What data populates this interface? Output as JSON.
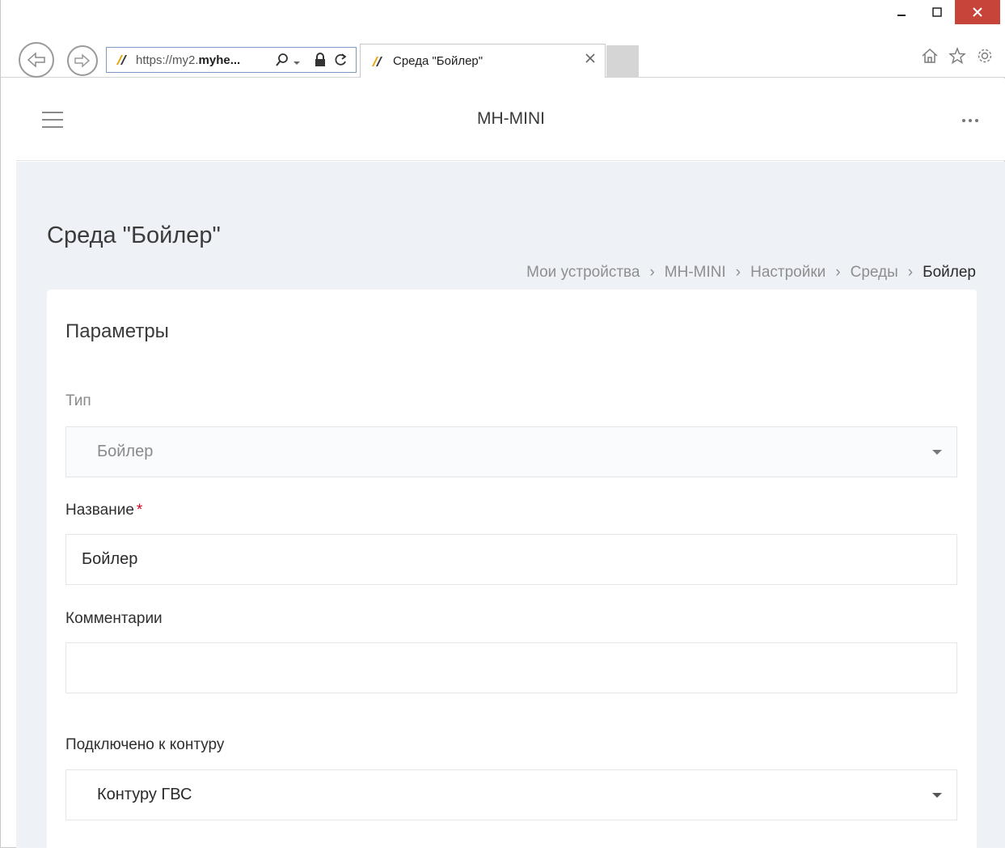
{
  "browser": {
    "address_url_prefix": "https://my2.",
    "address_url_domain": "myhe...",
    "tab_title": "Среда \"Бойлер\""
  },
  "app": {
    "title": "MH-MINI"
  },
  "page": {
    "title": "Среда \"Бойлер\"",
    "breadcrumb": [
      "Мои устройства",
      "MH-MINI",
      "Настройки",
      "Среды",
      "Бойлер"
    ]
  },
  "form": {
    "section_title": "Параметры",
    "type": {
      "label": "Тип",
      "value": "Бойлер"
    },
    "name": {
      "label": "Название",
      "required_mark": "*",
      "value": "Бойлер"
    },
    "comments": {
      "label": "Комментарии",
      "value": ""
    },
    "circuit": {
      "label": "Подключено к контуру",
      "value": "Контуру ГВС"
    }
  },
  "colors": {
    "content_bg": "#eef1f6",
    "close_button": "#c7443b",
    "required": "#d0021b"
  }
}
